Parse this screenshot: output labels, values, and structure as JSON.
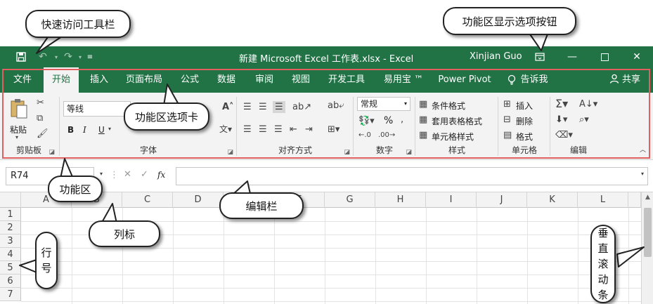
{
  "titlebar": {
    "title": "新建 Microsoft Excel 工作表.xlsx  -  Excel",
    "user": "Xinjian Guo"
  },
  "tabs": [
    {
      "label": "文件"
    },
    {
      "label": "开始"
    },
    {
      "label": "插入"
    },
    {
      "label": "页面布局"
    },
    {
      "label": "公式"
    },
    {
      "label": "数据"
    },
    {
      "label": "审阅"
    },
    {
      "label": "视图"
    },
    {
      "label": "开发工具"
    },
    {
      "label": "易用宝 ™"
    },
    {
      "label": "Power Pivot"
    },
    {
      "label": "告诉我"
    }
  ],
  "share_label": "共享",
  "ribbon": {
    "clipboard": {
      "paste": "粘贴",
      "label": "剪贴板"
    },
    "font": {
      "font_name": "等线",
      "bold": "B",
      "italic": "I",
      "underline": "U",
      "label": "字体"
    },
    "alignment": {
      "label": "对齐方式"
    },
    "number": {
      "format": "常规",
      "percent": "%",
      "label": "数字"
    },
    "styles": {
      "cond_format": "条件格式",
      "table_format": "套用表格格式",
      "cell_styles": "单元格样式",
      "label": "样式"
    },
    "cells": {
      "insert": "插入",
      "delete": "删除",
      "format": "格式",
      "label": "单元格"
    },
    "editing": {
      "label": "编辑"
    }
  },
  "formula_bar": {
    "name_box": "R74",
    "fx": "fx"
  },
  "grid": {
    "columns": [
      "A",
      "B",
      "C",
      "D",
      "E",
      "F",
      "G",
      "H",
      "I",
      "J",
      "K",
      "L"
    ],
    "rows": [
      "1",
      "2",
      "3",
      "4",
      "5",
      "6",
      "7"
    ]
  },
  "callouts": {
    "quick_access": "快速访问工具栏",
    "ribbon_button": "功能区显示选项按钮",
    "ribbon_tabs": "功能区选项卡",
    "ribbon": "功能区",
    "formula_bar": "编辑栏",
    "col_label": "列标",
    "row_label": "行号",
    "vscroll": "垂直滚动条"
  },
  "colors": {
    "accent": "#217346",
    "highlight": "#e06060"
  }
}
